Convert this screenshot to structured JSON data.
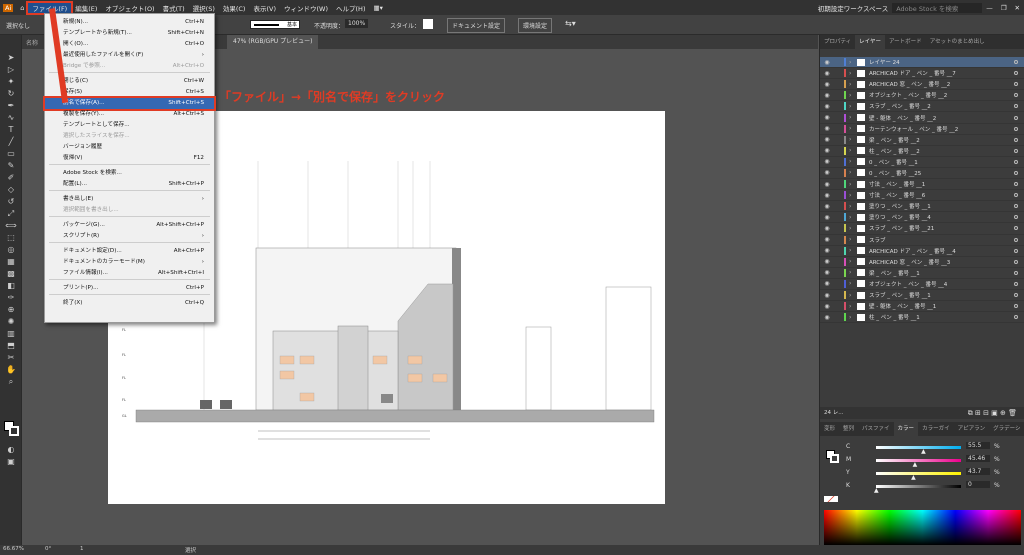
{
  "menubar": {
    "items": [
      "ファイル(F)",
      "編集(E)",
      "オブジェクト(O)",
      "書式(T)",
      "選択(S)",
      "効果(C)",
      "表示(V)",
      "ウィンドウ(W)",
      "ヘルプ(H)"
    ],
    "workspace": "初期設定ワークスペース",
    "search_placeholder": "Adobe Stock を検索"
  },
  "ctrlbar": {
    "selection_label": "選択なし",
    "stroke_label": "基本",
    "opacity_label": "不透明度：",
    "opacity_value": "100%",
    "style_label": "スタイル：",
    "doc_settings": "ドキュメント設定",
    "prefs": "環境設定"
  },
  "tab": {
    "title": "47% (RGB/GPU プレビュー)",
    "left_fragment": "名称"
  },
  "file_menu": {
    "items": [
      {
        "label": "新規(N)...",
        "shortcut": "Ctrl+N"
      },
      {
        "label": "テンプレートから新規(T)...",
        "shortcut": "Shift+Ctrl+N"
      },
      {
        "label": "開く(O)...",
        "shortcut": "Ctrl+O"
      },
      {
        "label": "最近使用したファイルを開く(F)",
        "shortcut": "›"
      },
      {
        "label": "Bridge で参照...",
        "shortcut": "Alt+Ctrl+O",
        "disabled": true
      },
      {
        "label": "閉じる(C)",
        "shortcut": "Ctrl+W"
      },
      {
        "label": "保存(S)",
        "shortcut": "Ctrl+S"
      },
      {
        "label": "別名で保存(A)...",
        "shortcut": "Shift+Ctrl+S",
        "highlight": true
      },
      {
        "label": "複製を保存(Y)...",
        "shortcut": "Alt+Ctrl+S"
      },
      {
        "label": "テンプレートとして保存...",
        "shortcut": ""
      },
      {
        "label": "選択したスライスを保存...",
        "shortcut": "",
        "disabled": true
      },
      {
        "label": "バージョン履歴",
        "shortcut": ""
      },
      {
        "label": "復帰(V)",
        "shortcut": "F12"
      },
      {
        "label": "Adobe Stock を検索...",
        "shortcut": ""
      },
      {
        "label": "配置(L)...",
        "shortcut": "Shift+Ctrl+P"
      },
      {
        "label": "書き出し(E)",
        "shortcut": "›"
      },
      {
        "label": "選択範囲を書き出し...",
        "shortcut": "",
        "disabled": true
      },
      {
        "label": "パッケージ(G)...",
        "shortcut": "Alt+Shift+Ctrl+P"
      },
      {
        "label": "スクリプト(R)",
        "shortcut": "›"
      },
      {
        "label": "ドキュメント設定(D)...",
        "shortcut": "Alt+Ctrl+P"
      },
      {
        "label": "ドキュメントのカラーモード(M)",
        "shortcut": "›"
      },
      {
        "label": "ファイル情報(I)...",
        "shortcut": "Alt+Shift+Ctrl+I"
      },
      {
        "label": "プリント(P)...",
        "shortcut": "Ctrl+P"
      },
      {
        "label": "終了(X)",
        "shortcut": "Ctrl+Q"
      }
    ]
  },
  "annotation": "「ファイル」→「別名で保存」をクリック",
  "layers_panel": {
    "tabs": [
      "プロパティ",
      "レイヤー",
      "アートボード",
      "アセットのまとめ出し"
    ],
    "layers": [
      {
        "name": "レイヤー 24",
        "color": "#4f7fd6"
      },
      {
        "name": "ARCHICAD ドア _ ペン _ 番号 __7",
        "color": "#d64f4f"
      },
      {
        "name": "ARCHICAD 窓 _ ペン _ 番号 __2",
        "color": "#d6a04f"
      },
      {
        "name": "オブジェクト _ ペン _ 番号 __2",
        "color": "#6fd64f"
      },
      {
        "name": "スラブ _ ペン _ 番号 __2",
        "color": "#4fd6c6"
      },
      {
        "name": "壁 - 躯体 _ ペン _ 番号 __2",
        "color": "#b04fd6"
      },
      {
        "name": "カーテンウォール _ ペン _ 番号 __2",
        "color": "#d64f9a"
      },
      {
        "name": "梁 _ ペン _ 番号 __2",
        "color": "#8a8a8a"
      },
      {
        "name": "柱 _ ペン _ 番号 __2",
        "color": "#d6d64f"
      },
      {
        "name": "0 _ ペン _ 番号 __1",
        "color": "#4f6fd6"
      },
      {
        "name": "0 _ ペン _ 番号 __25",
        "color": "#d6804f"
      },
      {
        "name": "寸法 _ ペン _ 番号 __1",
        "color": "#4fd67a"
      },
      {
        "name": "寸法 _ ペン _ 番号 __6",
        "color": "#9a4fd6"
      },
      {
        "name": "塗りつ _ ペン _ 番号 __1",
        "color": "#d64f4f"
      },
      {
        "name": "塗りつ _ ペン _ 番号 __4",
        "color": "#4fa8d6"
      },
      {
        "name": "スラブ _ ペン _ 番号 __21",
        "color": "#c6c64f"
      },
      {
        "name": "スラブ",
        "color": "#d6874f"
      },
      {
        "name": "ARCHICAD ドア _ ペン _ 番号 __4",
        "color": "#4fd6b0"
      },
      {
        "name": "ARCHICAD 窓 _ ペン _ 番号 __3",
        "color": "#d64fb8"
      },
      {
        "name": "梁 _ ペン _ 番号 __1",
        "color": "#7ad64f"
      },
      {
        "name": "オブジェクト _ ペン _ 番号 __4",
        "color": "#4f5fd6"
      },
      {
        "name": "スラブ _ ペン _ 番号 __1",
        "color": "#d6b84f"
      },
      {
        "name": "壁 - 躯体 _ ペン _ 番号 __1",
        "color": "#d64f6a"
      },
      {
        "name": "柱 _ ペン _ 番号 __1",
        "color": "#5fd64f"
      }
    ],
    "footer_count": "24 レ..."
  },
  "color_panel": {
    "tabs": [
      "変形",
      "整列",
      "パスファイ",
      "カラー",
      "カラーガイ",
      "アピアラン",
      "グラデーシ"
    ],
    "channels": [
      {
        "label": "C",
        "value": "55.5",
        "unit": "%",
        "level": 0.555,
        "grad": "linear-gradient(90deg,#fff,#00aeef)"
      },
      {
        "label": "M",
        "value": "45.46",
        "unit": "%",
        "level": 0.4546,
        "grad": "linear-gradient(90deg,#fff,#ec008c)"
      },
      {
        "label": "Y",
        "value": "43.7",
        "unit": "%",
        "level": 0.437,
        "grad": "linear-gradient(90deg,#fff,#fff200)"
      },
      {
        "label": "K",
        "value": "0",
        "unit": "%",
        "level": 0,
        "grad": "linear-gradient(90deg,#fff,#000)"
      }
    ]
  },
  "status": {
    "zoom": "66.67%",
    "angle": "0°",
    "artboard": "1",
    "tool": "選択"
  },
  "accent": "#e03b24"
}
